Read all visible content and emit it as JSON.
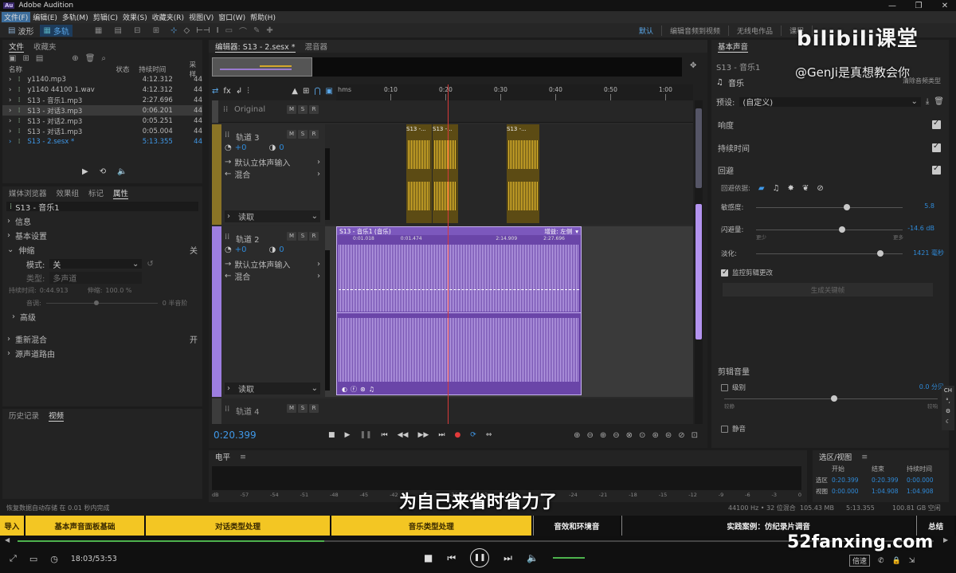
{
  "window": {
    "app_title": "Adobe Audition",
    "logo": "Au"
  },
  "menu": [
    "文件(F)",
    "编辑(E)",
    "多轨(M)",
    "剪辑(C)",
    "效果(S)",
    "收藏夹(R)",
    "视图(V)",
    "窗口(W)",
    "帮助(H)"
  ],
  "toolbar": {
    "waveform": "波形",
    "multitrack": "多轨"
  },
  "workspaces": [
    "默认",
    "编辑音频到视频",
    "无线电作品",
    "课程"
  ],
  "files_panel": {
    "tabs": [
      "文件",
      "收藏夹"
    ],
    "columns": {
      "name": "名称",
      "status": "状态",
      "duration": "持续时间",
      "rate": "采样"
    },
    "rows": [
      {
        "name": "y1140.mp3",
        "duration": "4:12.312",
        "rate": "44"
      },
      {
        "name": "y1140 44100 1.wav",
        "duration": "4:12.312",
        "rate": "44"
      },
      {
        "name": "S13 - 音乐1.mp3",
        "duration": "2:27.696",
        "rate": "44"
      },
      {
        "name": "S13 - 对话3.mp3",
        "duration": "0:06.201",
        "rate": "44"
      },
      {
        "name": "S13 - 对话2.mp3",
        "duration": "0:05.251",
        "rate": "44"
      },
      {
        "name": "S13 - 对话1.mp3",
        "duration": "0:05.004",
        "rate": "44"
      },
      {
        "name": "S13 - 2.sesx *",
        "duration": "5:13.355",
        "rate": "44"
      }
    ]
  },
  "props_panel": {
    "tabs": [
      "媒体浏览器",
      "效果组",
      "标记",
      "属性"
    ],
    "clip_name": "S13 - 音乐1",
    "sections": {
      "info": "信息",
      "basic": "基本设置",
      "stretch": "伸缩",
      "stretch_state": "关",
      "mode_label": "模式:",
      "mode_value": "关",
      "type_label": "类型:",
      "type_value": "多声道",
      "duration_label": "持续时间:",
      "duration_value": "0:44.913",
      "stretch_label": "伸缩:",
      "stretch_value": "100.0 %",
      "pitch_label": "音调:",
      "pitch_value": "0 半音阶",
      "advanced": "高级",
      "remix": "重新混合",
      "remix_state": "开",
      "routing": "源声道路由"
    }
  },
  "bottom_left_tabs": [
    "历史记录",
    "视频"
  ],
  "status": {
    "left": "恢复数据自动存储 在 0.01 秒内完成",
    "sample": "44100 Hz • 32 位混合",
    "size": "105.43 MB",
    "total": "5:13.355",
    "free": "100.81 GB 空闲"
  },
  "editor": {
    "tabs": [
      "编辑器: S13 - 2.sesx *",
      "混音器"
    ],
    "time_unit": "hms",
    "ruler": [
      "0:10",
      "0:20",
      "0:30",
      "0:40",
      "0:50",
      "1:00"
    ],
    "current_time": "0:20.399",
    "tracks": [
      {
        "name": "Original"
      },
      {
        "name": "轨道 3",
        "vol": "+0",
        "pan": "0",
        "input": "默认立体声输入",
        "output": "混合",
        "mode": "读取"
      },
      {
        "name": "轨道 2",
        "vol": "+0",
        "pan": "0",
        "input": "默认立体声输入",
        "output": "混合",
        "mode": "读取"
      },
      {
        "name": "轨道 4"
      }
    ],
    "clips": {
      "dialogue_a": "S13 -...",
      "dialogue_b": "S13 -...",
      "dialogue_c": "S13 -...",
      "music": "S13 - 音乐1 (音乐)",
      "music_gain": "增益: 左侧",
      "music_t1": "0:01.018",
      "music_t2": "0:01.474",
      "music_t3": "2:14.909",
      "music_t4": "2:27.696"
    },
    "msr": [
      "M",
      "S",
      "R"
    ]
  },
  "meter": {
    "title": "电平",
    "scale": [
      "dB",
      "-57",
      "-54",
      "-51",
      "-48",
      "-45",
      "-42",
      "-39",
      "-36",
      "-33",
      "-30",
      "-27",
      "-24",
      "-21",
      "-18",
      "-15",
      "-12",
      "-9",
      "-6",
      "-3",
      "0"
    ]
  },
  "essential_sound": {
    "title": "基本声音",
    "clip": "S13 - 音乐1",
    "clear": "清除音频类型",
    "category": "音乐",
    "preset_label": "预设:",
    "preset_value": "(自定义)",
    "loudness": "响度",
    "duration": "持续时间",
    "ducking": "回避",
    "duck_against": "回避依据:",
    "sensitivity": "敏感度:",
    "sensitivity_val": "5.8",
    "duck_amount": "闪避量:",
    "duck_amount_val": "-14.6 dB",
    "less": "更少",
    "more": "更多",
    "fades": "淡化:",
    "fades_val": "1421 毫秒",
    "monitor": "监控剪辑更改",
    "generate": "生成关键帧",
    "clip_volume": "剪辑音量",
    "level": "级别",
    "level_val": "0.0 分贝",
    "quieter": "较静",
    "louder": "较响",
    "mute": "静音"
  },
  "selection_panel": {
    "title": "选区/视图",
    "cols": [
      "开始",
      "结束",
      "持续时间"
    ],
    "rows": [
      {
        "label": "选区",
        "start": "0:20.399",
        "end": "0:20.399",
        "dur": "0:00.000"
      },
      {
        "label": "视图",
        "start": "0:00.000",
        "end": "1:04.908",
        "dur": "1:04.908"
      }
    ]
  },
  "overlay": {
    "watermark_brand": "bilibili课堂",
    "watermark_user": "@GenJi是真想教会你",
    "subtitle": "为自己来省时省力了",
    "site": "52fanxing.com"
  },
  "chapters": [
    {
      "label": "导入",
      "active": true
    },
    {
      "label": "基本声音面板基础",
      "active": true
    },
    {
      "label": "对话类型处理",
      "active": true
    },
    {
      "label": "音乐类型处理",
      "active": true
    },
    {
      "label": "音效和环境音",
      "active": false
    },
    {
      "label": "实践案例：仿纪录片调音",
      "active": false
    },
    {
      "label": "总结",
      "active": false
    }
  ],
  "player": {
    "time": "18:03/53:53",
    "speed": "倍速",
    "progress": 0.335
  },
  "colors": {
    "accent": "#2f8ad8",
    "dialogue": "#b8962a",
    "music": "#8a5cc7",
    "chapter": "#f3c623"
  }
}
